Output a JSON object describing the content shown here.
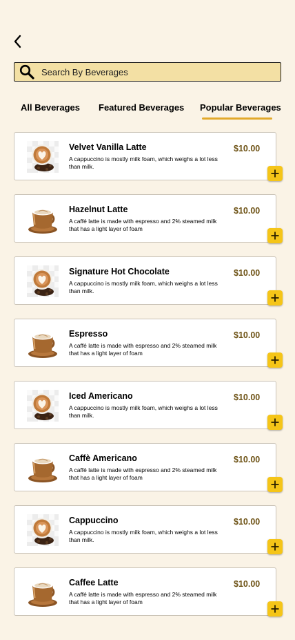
{
  "search": {
    "placeholder": "Search By Beverages"
  },
  "tabs": [
    {
      "label": "All Beverages"
    },
    {
      "label": "Featured Beverages"
    },
    {
      "label": "Popular Beverages",
      "active": true
    }
  ],
  "colors": {
    "accent": "#e2a92b",
    "price": "#6e5316",
    "add_button": "#f5c518",
    "search_bg": "#f3e0a4",
    "page_bg": "#faf3e6"
  },
  "items": [
    {
      "name": "Velvet Vanilla Latte",
      "desc": "A cappuccino is mostly milk foam, which weighs a lot less than milk.",
      "price": "$10.00",
      "image": "latte-art-cup-icon"
    },
    {
      "name": "Hazelnut Latte",
      "desc": "A caffé latte is made with espresso and 2% steamed milk that has a light layer of foam",
      "price": "$10.00",
      "image": "coffee-mug-icon"
    },
    {
      "name": "Signature Hot Chocolate",
      "desc": "A cappuccino is mostly milk foam, which weighs a lot less than milk.",
      "price": "$10.00",
      "image": "latte-art-cup-icon"
    },
    {
      "name": "Espresso",
      "desc": "A caffé latte is made with espresso and 2% steamed milk that has a light layer of foam",
      "price": "$10.00",
      "image": "coffee-mug-icon"
    },
    {
      "name": "Iced Americano",
      "desc": "A cappuccino is mostly milk foam, which weighs a lot less than milk.",
      "price": "$10.00",
      "image": "latte-art-cup-icon"
    },
    {
      "name": "Caffè Americano",
      "desc": "A caffé latte is made with espresso and 2% steamed milk that has a light layer of foam",
      "price": "$10.00",
      "image": "coffee-mug-icon"
    },
    {
      "name": "Cappuccino",
      "desc": "A cappuccino is mostly milk foam, which weighs a lot less than milk.",
      "price": "$10.00",
      "image": "latte-art-cup-icon"
    },
    {
      "name": "Caffee Latte",
      "desc": "A caffé latte is made with espresso and 2% steamed milk that has a light layer of foam",
      "price": "$10.00",
      "image": "coffee-mug-icon"
    }
  ]
}
